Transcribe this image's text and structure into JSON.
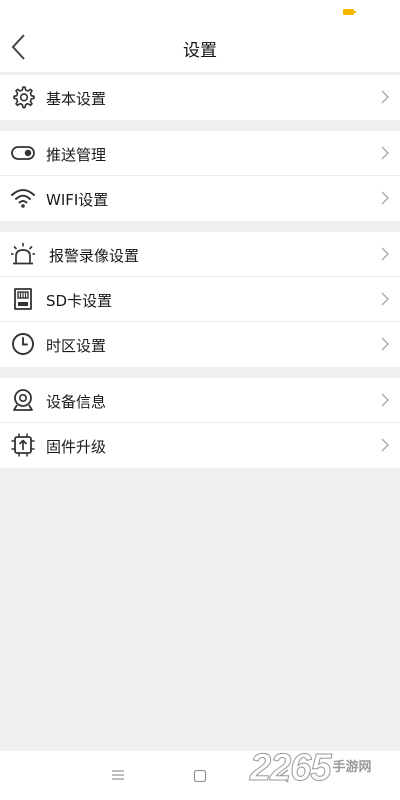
{
  "header": {
    "title": "设置"
  },
  "groups": [
    {
      "items": [
        {
          "label": "基本设置",
          "icon": "gear-icon"
        }
      ]
    },
    {
      "items": [
        {
          "label": "推送管理",
          "icon": "toggle-icon"
        },
        {
          "label": "WIFI设置",
          "icon": "wifi-icon"
        }
      ]
    },
    {
      "items": [
        {
          "label": "报警录像设置",
          "icon": "alarm-light-icon"
        },
        {
          "label": "SD卡设置",
          "icon": "sd-card-icon"
        },
        {
          "label": "时区设置",
          "icon": "clock-icon"
        }
      ]
    },
    {
      "items": [
        {
          "label": "设备信息",
          "icon": "camera-icon"
        },
        {
          "label": "固件升级",
          "icon": "firmware-upgrade-icon"
        }
      ]
    }
  ],
  "nav": {
    "menu_icon": "menu-icon",
    "home_icon": "square-icon",
    "back_icon": "back-triangle-icon"
  },
  "watermark": {
    "number": "2265",
    "text_top": "手游网",
    "text_bottom": ""
  },
  "colors": {
    "battery": "#f5b800",
    "background": "#efefef",
    "text": "#1a1a1a"
  }
}
